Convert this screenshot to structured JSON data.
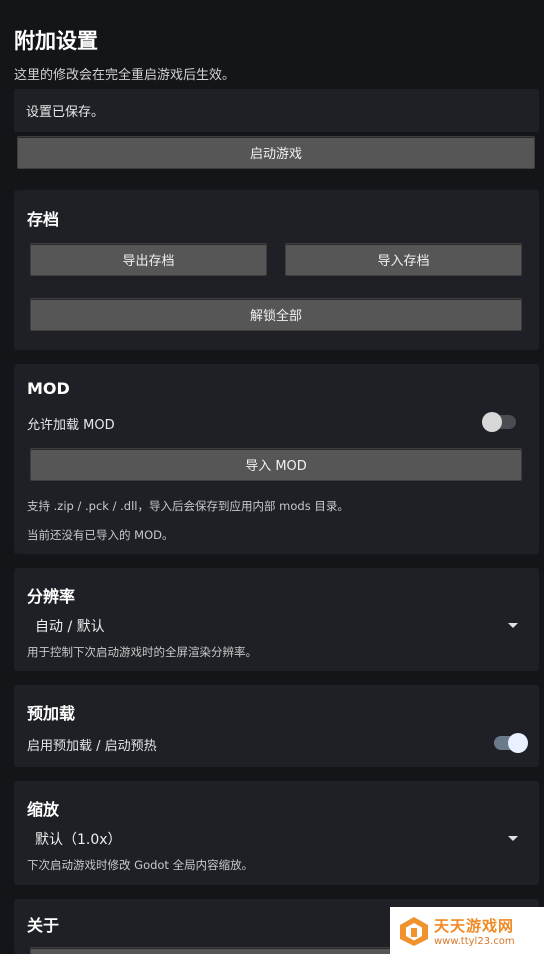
{
  "header": {
    "title": "附加设置",
    "subtitle": "这里的修改会在完全重启游戏后生效。"
  },
  "status": {
    "text": "设置已保存。"
  },
  "launch_button": "启动游戏",
  "save_section": {
    "title": "存档",
    "export_label": "导出存档",
    "import_label": "导入存档",
    "unlock_label": "解锁全部"
  },
  "mod_section": {
    "title": "MOD",
    "allow_label": "允许加载 MOD",
    "allow_enabled": false,
    "import_label": "导入 MOD",
    "hint_formats": "支持 .zip / .pck / .dll，导入后会保存到应用内部 mods 目录。",
    "hint_none": "当前还没有已导入的 MOD。"
  },
  "resolution_section": {
    "title": "分辨率",
    "selected": "自动 / 默认",
    "hint": "用于控制下次启动游戏时的全屏渲染分辨率。"
  },
  "preload_section": {
    "title": "预加载",
    "label": "启用预加载 / 启动预热",
    "enabled": true
  },
  "scale_section": {
    "title": "缩放",
    "selected": "默认（1.0x）",
    "hint": "下次启动游戏时修改 Godot 全局内容缩放。"
  },
  "about_section": {
    "title": "关于"
  },
  "watermark": {
    "name": "天天游戏网",
    "url": "www.ttyl23.com"
  },
  "colors": {
    "background": "#141519",
    "card": "#1e2026",
    "button": "#565656",
    "toggle_on_knob": "#e9f0ff"
  }
}
